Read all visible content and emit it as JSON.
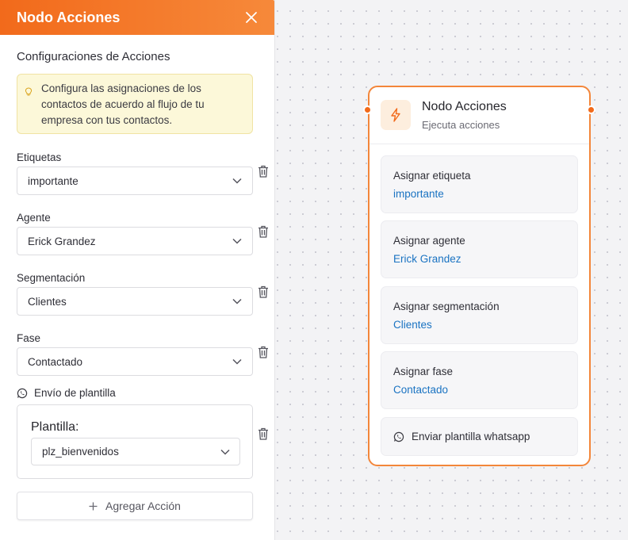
{
  "panel": {
    "title": "Nodo Acciones",
    "section_title": "Configuraciones de Acciones",
    "info_text": "Configura las asignaciones de los contactos de acuerdo al flujo de tu empresa con tus contactos.",
    "fields": [
      {
        "label": "Etiquetas",
        "value": "importante"
      },
      {
        "label": "Agente",
        "value": "Erick Grandez"
      },
      {
        "label": "Segmentación",
        "value": "Clientes"
      },
      {
        "label": "Fase",
        "value": "Contactado"
      }
    ],
    "template": {
      "section_label": "Envío de plantilla",
      "title": "Plantilla:",
      "value": "plz_bienvenidos"
    },
    "add_button": "Agregar Acción"
  },
  "node": {
    "title": "Nodo Acciones",
    "subtitle": "Ejecuta acciones",
    "actions": [
      {
        "title": "Asignar etiqueta",
        "value": "importante"
      },
      {
        "title": "Asignar agente",
        "value": "Erick Grandez"
      },
      {
        "title": "Asignar segmentación",
        "value": "Clientes"
      },
      {
        "title": "Asignar fase",
        "value": "Contactado"
      }
    ],
    "whatsapp_action": "Enviar plantilla whatsapp"
  },
  "colors": {
    "accent": "#f26a1b",
    "link": "#1a73c2",
    "info_bg": "#fcf8d9"
  },
  "icons": [
    "close-icon",
    "lightbulb-icon",
    "chevron-down-icon",
    "trash-icon",
    "whatsapp-icon",
    "plus-icon",
    "lightning-icon"
  ]
}
